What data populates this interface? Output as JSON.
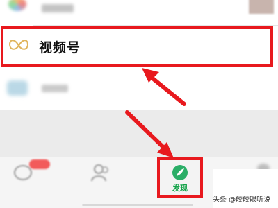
{
  "menu": {
    "moments_label": "",
    "channels_label": "视频号",
    "scan_label": ""
  },
  "tabbar": {
    "tabs": [
      {
        "id": "chats",
        "label": "",
        "badge": true
      },
      {
        "id": "contacts",
        "label": ""
      },
      {
        "id": "discover",
        "label": "发现",
        "active": true
      },
      {
        "id": "me",
        "label": ""
      }
    ]
  },
  "annotations": {
    "highlight_color": "#e8191e",
    "arrow_color": "#e8191e"
  },
  "watermark": "头条 @皎皎眼听说",
  "colors": {
    "accent_green": "#15a34a",
    "channels_icon": "#e0b45c"
  },
  "icons": {
    "channels": "channels-butterfly-icon",
    "discover": "compass-icon",
    "chats": "chat-bubble-icon",
    "contacts": "contacts-icon",
    "scan": "scan-icon",
    "moments": "moments-icon"
  }
}
